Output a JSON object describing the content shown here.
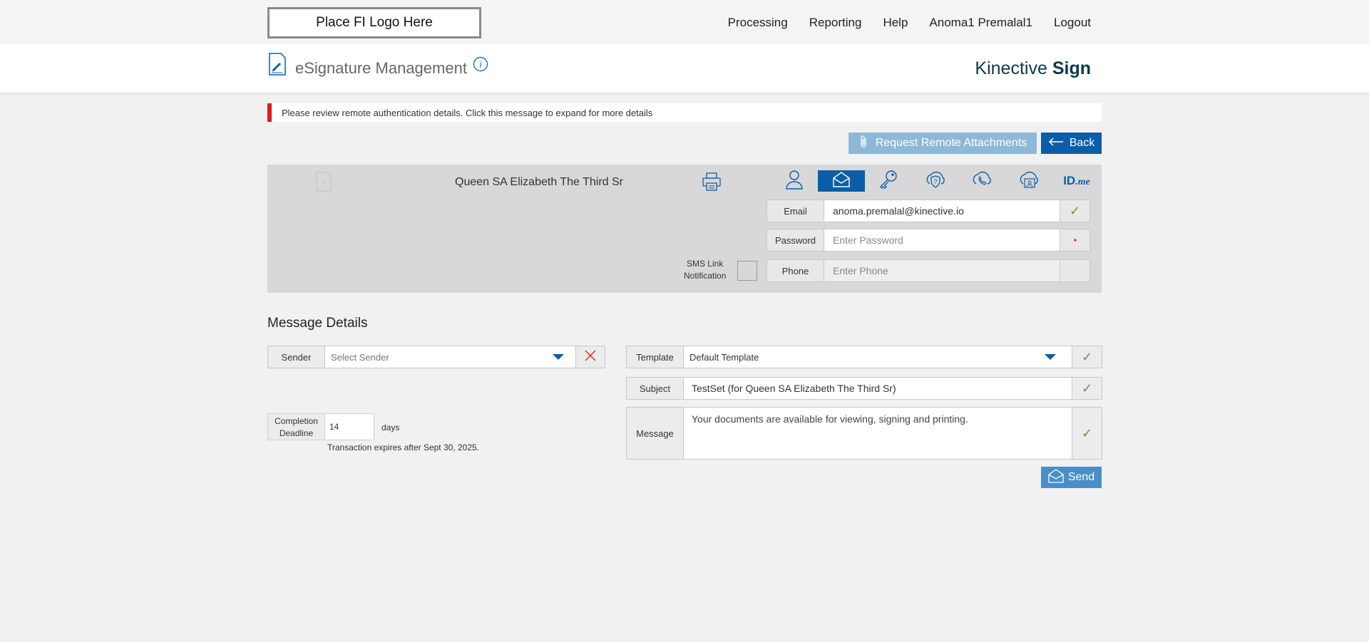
{
  "top": {
    "logo_text": "Place FI Logo Here",
    "nav": [
      "Processing",
      "Reporting",
      "Help",
      "Anoma1 Premalal1",
      "Logout"
    ]
  },
  "header": {
    "title": "eSignature Management",
    "brand_light": "Kinective",
    "brand_bold": "Sign"
  },
  "alert": {
    "text": "Please review remote authentication details. Click this message to expand for more details",
    "color": "#e31b1b"
  },
  "actions": {
    "attach_label": "Request Remote Attachments",
    "back_label": "Back"
  },
  "recipient": {
    "name": "Queen SA Elizabeth The Third Sr",
    "auth_methods": [
      "person-icon",
      "email-icon",
      "key-icon",
      "shield-question-icon",
      "phone-icon",
      "id-card-icon",
      "idme-logo"
    ],
    "active_method": "email-icon",
    "idme_text": "ID",
    "idme_suffix": ".me",
    "email_label": "Email",
    "email_value": "anoma.premalal@kinective.io",
    "password_label": "Password",
    "password_placeholder": "Enter Password",
    "phone_label": "Phone",
    "phone_placeholder": "Enter Phone",
    "sms_label_line1": "SMS Link",
    "sms_label_line2": "Notification"
  },
  "message_details": {
    "title": "Message Details",
    "sender_label": "Sender",
    "sender_placeholder": "Select Sender",
    "template_label": "Template",
    "template_value": "Default Template",
    "subject_label": "Subject",
    "subject_value": "TestSet (for Queen SA Elizabeth The Third Sr)",
    "message_label": "Message",
    "message_value": "Your documents are available for viewing, signing and printing.",
    "deadline_label_line1": "Completion",
    "deadline_label_line2": "Deadline",
    "deadline_value": "14",
    "days_label": "days",
    "expires_text": "Transaction expires after Sept 30, 2025.",
    "send_label": "Send",
    "check_glyph": "✓"
  },
  "colors": {
    "primary": "#0a5ea8",
    "check": "#6a9a3a",
    "danger": "#e31b1b"
  }
}
